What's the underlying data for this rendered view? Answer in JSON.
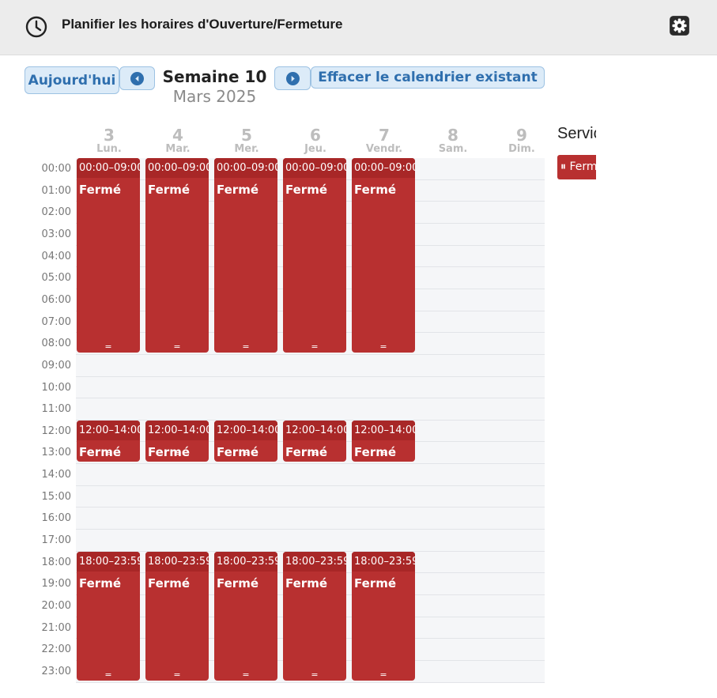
{
  "header": {
    "title": "Planifier les horaires d'Ouverture/Fermeture",
    "icons": [
      "clock-icon",
      "gear-icon"
    ]
  },
  "toolbar": {
    "today_label": "Aujourd'hui",
    "week_title": "Semaine 10",
    "month_title": "Mars 2025",
    "clear_label": "Effacer le calendrier existant",
    "icons": [
      "chevron-left-icon",
      "chevron-right-icon"
    ]
  },
  "days": [
    {
      "number": "3",
      "label": "Lun."
    },
    {
      "number": "4",
      "label": "Mar."
    },
    {
      "number": "5",
      "label": "Mer."
    },
    {
      "number": "6",
      "label": "Jeu."
    },
    {
      "number": "7",
      "label": "Vendr."
    },
    {
      "number": "8",
      "label": "Sam."
    },
    {
      "number": "9",
      "label": "Dim."
    }
  ],
  "hours": [
    "00:00",
    "01:00",
    "02:00",
    "03:00",
    "04:00",
    "05:00",
    "06:00",
    "07:00",
    "08:00",
    "09:00",
    "10:00",
    "11:00",
    "12:00",
    "13:00",
    "14:00",
    "15:00",
    "16:00",
    "17:00",
    "18:00",
    "19:00",
    "20:00",
    "21:00",
    "22:00",
    "23:00"
  ],
  "event_label": "Fermé",
  "event_handle": "=",
  "event_blocks": [
    {
      "time": "00:00–09:00",
      "start": 0,
      "end": 9
    },
    {
      "time": "12:00–14:00",
      "start": 12,
      "end": 14
    },
    {
      "time": "18:00–23:59",
      "start": 18,
      "end": 24
    }
  ],
  "event_days": 5,
  "services": {
    "title": "Servic",
    "chip_label": "⏸ Ferm"
  },
  "colors": {
    "event": "#b83030",
    "event_header": "#a82727",
    "accent": "#2f6fae",
    "button_bg": "#dcebf8"
  }
}
